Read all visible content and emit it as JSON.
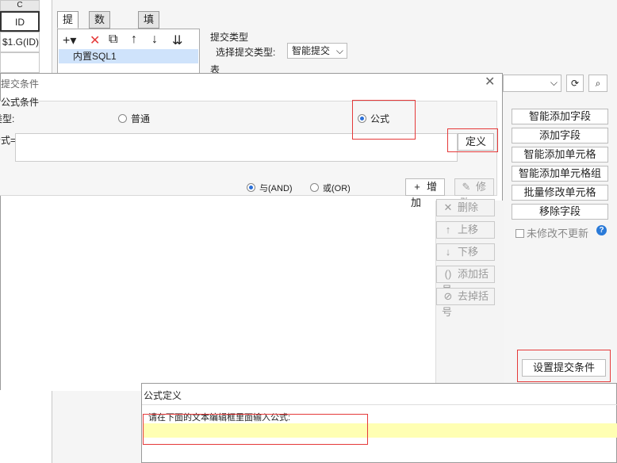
{
  "sheet": {
    "col_header": "C",
    "cell1": "ID",
    "cell2": "$1.G(ID)"
  },
  "bg": {
    "tabs": [
      "提交",
      "数据校验",
      "填报快捷键设置"
    ],
    "list_item": "内置SQL1",
    "submit_type_label": "提交类型",
    "select_submit_type_label": "选择提交类型:",
    "select_submit_type_value": "智能提交",
    "table_label": "表",
    "right_buttons": [
      "智能添加字段",
      "添加字段",
      "智能添加单元格",
      "智能添加单元格组",
      "批量修改单元格",
      "移除字段"
    ],
    "unmodified_label": "未修改不更新",
    "set_condition_button": "设置提交条件"
  },
  "dialog": {
    "title": "提交条件",
    "group_label": "公式条件",
    "type_label": "类型:",
    "radio_normal": "普通",
    "radio_formula": "公式",
    "formula_label": "公式=",
    "define_button": "定义",
    "and_label": "与(AND)",
    "or_label": "或(OR)",
    "add_button": "增加",
    "modify_button": "修改",
    "delete_button": "删除",
    "up_button": "上移",
    "down_button": "下移",
    "add_paren_button": "添加括号",
    "remove_paren_button": "去掉括号"
  },
  "formula_dialog": {
    "title": "公式定义",
    "instruction": "请在下面的文本编辑框里面输入公式:"
  },
  "colors": {
    "highlight": "#ffffb3",
    "red": "#e53939",
    "selection": "#cfe3fb"
  }
}
